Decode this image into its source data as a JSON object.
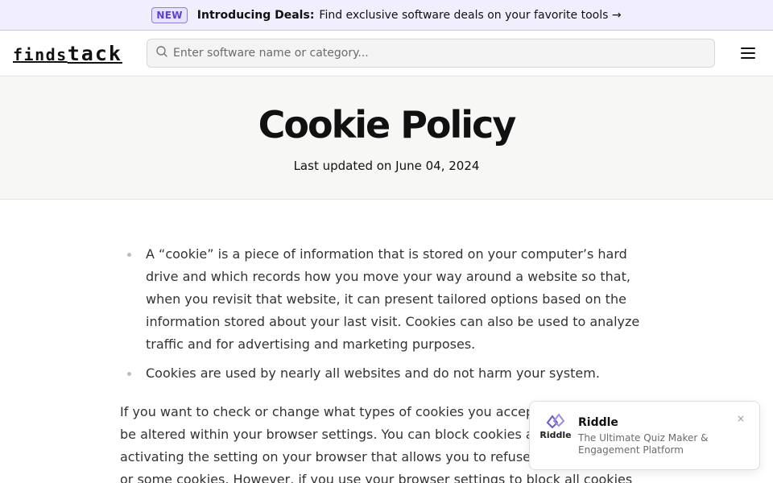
{
  "announcement": {
    "badge": "NEW",
    "title": "Introducing Deals:",
    "text": "Find exclusive software deals on your favorite tools →"
  },
  "header": {
    "logo_part1": "finds",
    "logo_part2": "tack",
    "search_placeholder": "Enter software name or category...",
    "search_icon": "search-icon",
    "menu_icon": "hamburger-menu-icon"
  },
  "hero": {
    "title": "Cookie Policy",
    "updated": "Last updated on June 04, 2024"
  },
  "content": {
    "bullets": [
      "A “cookie” is a piece of information that is stored on your computer’s hard drive and which records how you move your way around a website so that, when you revisit that website, it can present tailored options based on the information stored about your last visit. Cookies can also be used to analyze traffic and for advertising and marketing purposes.",
      "Cookies are used by nearly all websites and do not harm your system."
    ],
    "paragraph": "If you want to check or change what types of cookies you accept, this can usually be altered within your browser settings. You can block cookies at any time by activating the setting on your browser that allows you to refuse the setting of all or some cookies. However, if you use your browser settings to block all cookies"
  },
  "toast": {
    "logo_text": "Riddle",
    "title": "Riddle",
    "subtitle": "The Ultimate Quiz Maker & Engagement Platform",
    "close": "×",
    "accent": "#6a5acd"
  }
}
